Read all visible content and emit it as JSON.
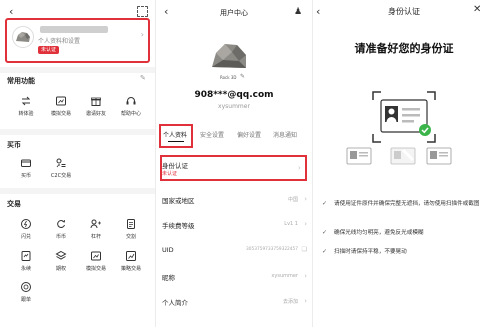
{
  "panel1": {
    "profile_sub": "个人资料和设置",
    "profile_badge": "未认证",
    "common_title": "常用功能",
    "common_items": [
      "转体验",
      "模拟交易",
      "邀请好友",
      "帮助中心"
    ],
    "buy_title": "买币",
    "buy_items": [
      "买币",
      "C2C交易"
    ],
    "trade_title": "交易",
    "trade_items": [
      "闪兑",
      "币币",
      "杠杆",
      "交割",
      "永续",
      "期权",
      "模拟交易",
      "策略交易",
      "跟单"
    ]
  },
  "panel2": {
    "title": "用户中心",
    "avatar_label": "Rock 3D",
    "email": "908***@qq.com",
    "username": "xysummer",
    "tabs": [
      "个人资料",
      "安全设置",
      "偏好设置",
      "消息通知"
    ],
    "identity_label": "身份认证",
    "identity_status": "未认证",
    "rows": [
      {
        "label": "国家或地区",
        "value": "中国"
      },
      {
        "label": "手续费等级",
        "value": "Lv1 1"
      },
      {
        "label": "UID",
        "value": "3053759733759322457"
      },
      {
        "label": "昵称",
        "value": "xysummer"
      },
      {
        "label": "个人简介",
        "value": "去添加"
      }
    ]
  },
  "panel3": {
    "title": "身份认证",
    "heading": "请准备好您的身份证",
    "bullets": [
      "请使用证件原件并确保完整无遮挡，请勿使用扫描件或截图",
      "确保光线均匀明亮，避免反光或模糊",
      "扫描时请保持平稳，不要晃动"
    ]
  },
  "colors": {
    "accent": "#e0313a",
    "success": "#3bb54a"
  }
}
